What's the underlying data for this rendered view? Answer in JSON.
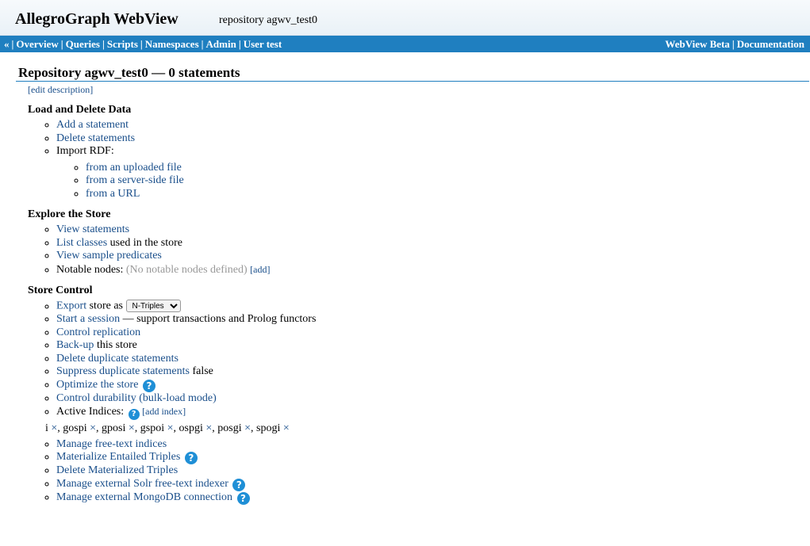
{
  "header": {
    "app_title": "AllegroGraph WebView",
    "repo_label": "repository agwv_test0"
  },
  "nav": {
    "back": "«",
    "left_items": [
      "Overview",
      "Queries",
      "Scripts",
      "Namespaces",
      "Admin",
      "User test"
    ],
    "right_items": [
      "WebView Beta",
      "Documentation"
    ]
  },
  "page": {
    "heading": "Repository agwv_test0 — 0 statements",
    "edit_description": "[edit description]"
  },
  "load_delete": {
    "title": "Load and Delete Data",
    "add_statement": "Add a statement",
    "delete_statements": "Delete statements",
    "import_rdf": "Import RDF:",
    "import_uploaded": "from an uploaded file",
    "import_server": "from a server-side file",
    "import_url": "from a URL"
  },
  "explore": {
    "title": "Explore the Store",
    "view_statements": "View statements",
    "list_classes": "List classes",
    "list_classes_suffix": " used in the store",
    "view_predicates": "View sample predicates",
    "notable_label": "Notable nodes: ",
    "notable_none": "(No notable nodes defined)",
    "notable_add": "[add]"
  },
  "control": {
    "title": "Store Control",
    "export": "Export",
    "export_suffix": " store as ",
    "export_format": "N-Triples",
    "start_session": "Start a session",
    "start_session_suffix": " — support transactions and Prolog functors",
    "control_replication": "Control replication",
    "backup": "Back-up",
    "backup_suffix": " this store",
    "delete_duplicates": "Delete duplicate statements",
    "suppress_duplicates": "Suppress duplicate statements",
    "suppress_value": " false",
    "optimize": "Optimize the store",
    "durability": "Control durability (bulk-load mode)",
    "active_indices_label": "Active Indices: ",
    "add_index": "[add index]",
    "indices": [
      "i",
      "gospi",
      "gposi",
      "gspoi",
      "ospgi",
      "posgi",
      "spogi"
    ],
    "delete_mark": "×",
    "manage_freetext": "Manage free-text indices",
    "materialize": "Materialize Entailed Triples",
    "delete_materialized": "Delete Materialized Triples",
    "solr": "Manage external Solr free-text indexer",
    "mongodb": "Manage external MongoDB connection"
  },
  "icons": {
    "help": "?"
  },
  "colors": {
    "nav_bar": "#1f7fc0",
    "link": "#1a4f8b",
    "help_icon": "#1f8fd6"
  }
}
